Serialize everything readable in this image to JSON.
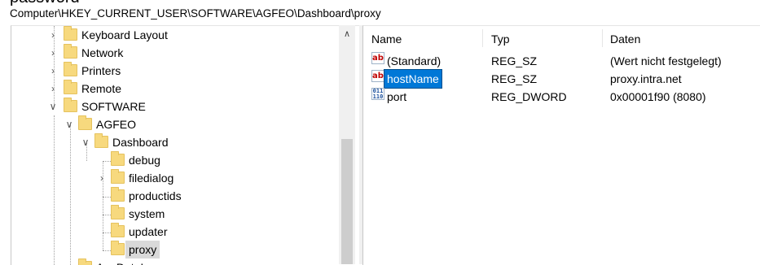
{
  "window_top_fragment": "password",
  "address_path": "Computer\\HKEY_CURRENT_USER\\SOFTWARE\\AGFEO\\Dashboard\\proxy",
  "tree": {
    "keyboard_layout": "Keyboard Layout",
    "network": "Network",
    "printers": "Printers",
    "remote": "Remote",
    "software": "SOFTWARE",
    "agfeo": "AGFEO",
    "dashboard": "Dashboard",
    "debug": "debug",
    "filedialog": "filedialog",
    "productids": "productids",
    "system": "system",
    "updater": "updater",
    "proxy": "proxy",
    "cut_next": "AppDataLow"
  },
  "columns": {
    "name": "Name",
    "type": "Typ",
    "data": "Daten"
  },
  "values": [
    {
      "icon": "string-value-icon",
      "name": "(Standard)",
      "type": "REG_SZ",
      "data": "(Wert nicht festgelegt)"
    },
    {
      "icon": "string-value-icon",
      "name": "hostName",
      "type": "REG_SZ",
      "data": "proxy.intra.net"
    },
    {
      "icon": "dword-value-icon",
      "name": "port",
      "type": "REG_DWORD",
      "data": "0x00001f90 (8080)"
    }
  ],
  "colors": {
    "selection": "#0078d7",
    "folder": "#f7d97e",
    "tree_selected": "#d9d9d9"
  }
}
